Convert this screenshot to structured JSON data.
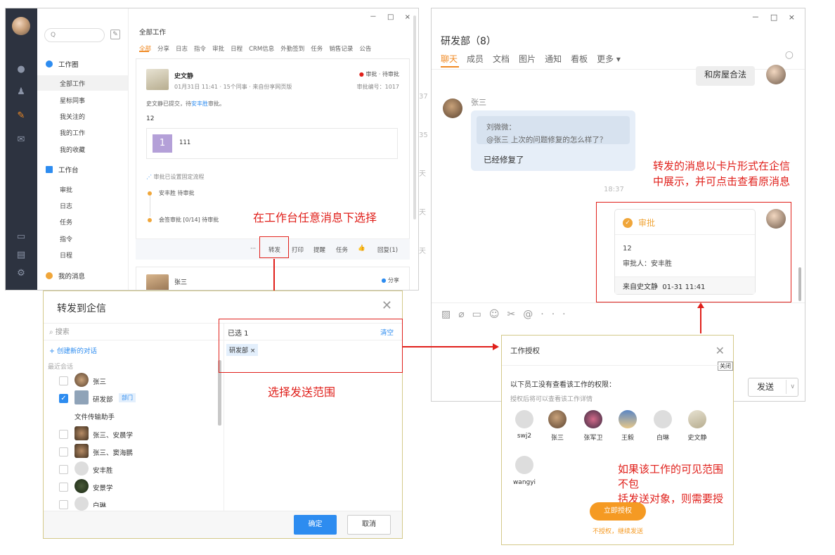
{
  "left_window": {
    "controls": "－ □ ×",
    "search_placeholder": "Q",
    "nav": {
      "section1": "工作圈",
      "items1": [
        "全部工作",
        "星标同事",
        "我关注的",
        "我的工作",
        "我的收藏"
      ],
      "section2": "工作台",
      "items2": [
        "审批",
        "日志",
        "任务",
        "指令",
        "日程"
      ],
      "section3": "我的消息"
    },
    "feed": {
      "title": "全部工作",
      "tabs": [
        "全部",
        "分享",
        "日志",
        "指令",
        "审批",
        "日程",
        "CRM信息",
        "外勤签到",
        "任务",
        "销售记录",
        "公告"
      ],
      "card": {
        "author": "史文静",
        "meta": "01月31日 11:41 · 15个同事 · 来自份享网页版",
        "status": "审批 · 待审批",
        "number": "审批编号：1017",
        "desc_prefix": "史文静已提交，待",
        "desc_link": "安丰胜",
        "desc_suffix": "审批。",
        "amount": "12",
        "attach_num": "1",
        "attach_text": "111",
        "flow_title": "审批已设置固定流程",
        "flow1": "安丰胜  待审批",
        "flow2": "会签审批 [0/14]  待审批",
        "actions": [
          "···",
          "转发",
          "打印",
          "提醒",
          "任务",
          "👍",
          "回复(1)"
        ]
      },
      "card2": {
        "author": "张三",
        "status": "分享"
      }
    }
  },
  "annotations": {
    "a1": "在工作台任意消息下选择",
    "a2": "选择发送范围",
    "a3_line1": "转发的消息以卡片形式在企信",
    "a3_line2": "中展示，并可点击查看原消息",
    "a4_line1": "如果该工作的可见范围不包",
    "a4_line2": "括发送对象，则需要授权"
  },
  "chat_window": {
    "controls": "－ □ ×",
    "title": "研发部（8）",
    "tabs": [
      "聊天",
      "成员",
      "文档",
      "图片",
      "通知",
      "看板",
      "更多 ▾"
    ],
    "side_nums": [
      "37",
      "35",
      "天",
      "天",
      "天",
      "天"
    ],
    "msg_top": "和房屋合法",
    "sender": "张三",
    "quote_name": "刘微微：",
    "quote_text": "@张三 上次的问题修复的怎么样了？",
    "reply": "已经修复了",
    "time": "18:37",
    "card": {
      "type": "审批",
      "amount": "12",
      "approver": "审批人：安丰胜",
      "source": "来自史文静",
      "date": "01-31 11:41"
    },
    "send": "发送",
    "toolbar_more": "···"
  },
  "forward_dialog": {
    "title": "转发到企信",
    "search_placeholder": "搜索",
    "new_chat": "+ 创建新的对话",
    "recent": "最近会话",
    "items": [
      {
        "name": "张三",
        "checked": false,
        "tag": ""
      },
      {
        "name": "研发部",
        "checked": true,
        "tag": "部门"
      },
      {
        "name": "文件传输助手",
        "checked": false,
        "tag": ""
      },
      {
        "name": "张三、安晨学",
        "checked": false,
        "tag": ""
      },
      {
        "name": "张三、窦海鹏",
        "checked": false,
        "tag": ""
      },
      {
        "name": "安丰胜",
        "checked": false,
        "tag": ""
      },
      {
        "name": "安景学",
        "checked": false,
        "tag": ""
      },
      {
        "name": "白琳",
        "checked": false,
        "tag": ""
      }
    ],
    "selected_label": "已选  1",
    "clear": "清空",
    "selected_chip": "研发部 ×",
    "ok": "确定",
    "cancel": "取消"
  },
  "auth_dialog": {
    "title": "工作授权",
    "close_tip": "关闭",
    "line1": "以下员工没有查看该工作的权限：",
    "line2": "授权后将可以查看该工作详情",
    "users": [
      "swj2",
      "张三",
      "张军卫",
      "王毅",
      "白琳",
      "史文静",
      "wangyi"
    ],
    "authorize": "立即授权",
    "skip": "不授权，继续发送"
  },
  "colors": {
    "accent": "#f08a24",
    "blue": "#2d8cf0",
    "red": "#e0201b",
    "sidebar": "#2d3340"
  }
}
